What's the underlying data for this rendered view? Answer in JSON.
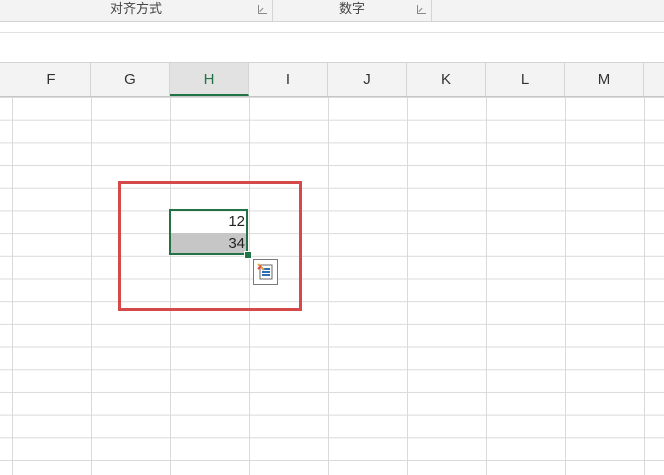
{
  "ribbon": {
    "groups": [
      {
        "label": "对齐方式"
      },
      {
        "label": "数字"
      }
    ]
  },
  "columns": [
    "F",
    "G",
    "H",
    "I",
    "J",
    "K",
    "L",
    "M"
  ],
  "active_column": "H",
  "cells": {
    "h1": "12",
    "h2": "34"
  },
  "icons": {
    "launcher": "dialog-launcher-icon",
    "quick_analysis": "quick-analysis-icon"
  },
  "colors": {
    "accent": "#217346",
    "highlight_box": "#d44a4a",
    "selected_cell_fill": "#c6c6c6"
  }
}
